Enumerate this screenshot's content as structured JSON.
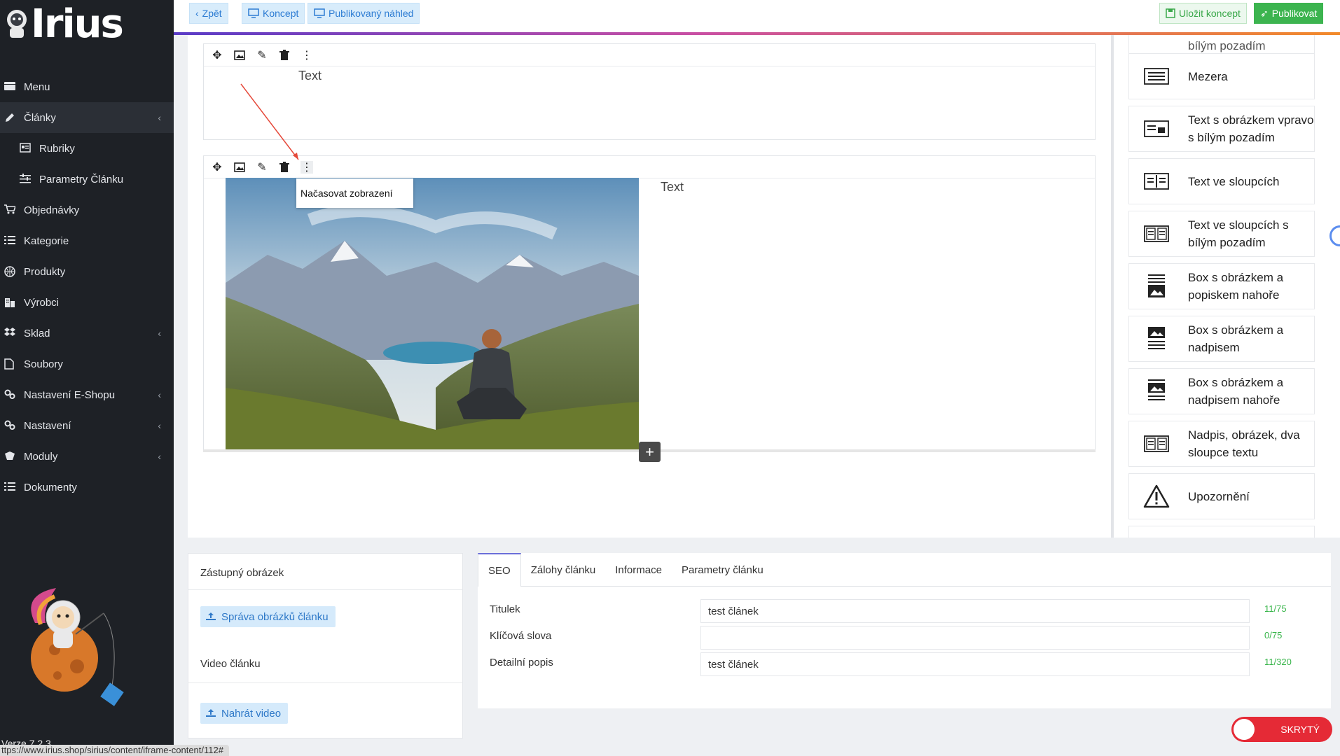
{
  "app": {
    "logo_text": "Irius",
    "version": "Verze 7.2.3",
    "status_url": "ttps://www.irius.shop/sirius/content/iframe-content/112#"
  },
  "sidebar": {
    "items": [
      {
        "label": "Menu",
        "icon": "menu-icon",
        "active": false,
        "sub": false,
        "chevron": false
      },
      {
        "label": "Články",
        "icon": "pencil-icon",
        "active": true,
        "sub": false,
        "chevron": true
      },
      {
        "label": "Rubriky",
        "icon": "newspaper-icon",
        "active": false,
        "sub": true,
        "chevron": false
      },
      {
        "label": "Parametry Článku",
        "icon": "sliders-icon",
        "active": false,
        "sub": true,
        "chevron": false
      },
      {
        "label": "Objednávky",
        "icon": "cart-icon",
        "active": false,
        "sub": false,
        "chevron": false
      },
      {
        "label": "Kategorie",
        "icon": "list-icon",
        "active": false,
        "sub": false,
        "chevron": false
      },
      {
        "label": "Produkty",
        "icon": "basketball-icon",
        "active": false,
        "sub": false,
        "chevron": false
      },
      {
        "label": "Výrobci",
        "icon": "building-icon",
        "active": false,
        "sub": false,
        "chevron": false
      },
      {
        "label": "Sklad",
        "icon": "dropbox-icon",
        "active": false,
        "sub": false,
        "chevron": true
      },
      {
        "label": "Soubory",
        "icon": "file-icon",
        "active": false,
        "sub": false,
        "chevron": false
      },
      {
        "label": "Nastavení E-Shopu",
        "icon": "cogs-icon",
        "active": false,
        "sub": false,
        "chevron": true
      },
      {
        "label": "Nastavení",
        "icon": "cogs-icon",
        "active": false,
        "sub": false,
        "chevron": true
      },
      {
        "label": "Moduly",
        "icon": "modules-icon",
        "active": false,
        "sub": false,
        "chevron": true
      },
      {
        "label": "Dokumenty",
        "icon": "list-icon",
        "active": false,
        "sub": false,
        "chevron": false
      }
    ]
  },
  "topbar": {
    "back": "Zpět",
    "draft": "Koncept",
    "published_preview": "Publikovaný náhled",
    "save_draft": "Uložit koncept",
    "publish": "Publikovat"
  },
  "editor": {
    "block1_text": "Text",
    "block2_text": "Text",
    "tooltip": "Načasovat zobrazení"
  },
  "palette": {
    "cut_top_label": "bílým pozadím",
    "items": [
      {
        "label": "Mezera",
        "icon": "text-align-icon"
      },
      {
        "label": "Text s obrázkem vpravo s bílým pozadím",
        "icon": "text-image-right-icon"
      },
      {
        "label": "Text ve sloupcích",
        "icon": "columns-icon"
      },
      {
        "label": "Text ve sloupcích s bílým pozadím",
        "icon": "columns-bordered-icon"
      },
      {
        "label": "Box s obrázkem a popiskem nahoře",
        "icon": "box-caption-top-icon"
      },
      {
        "label": "Box s obrázkem a nadpisem",
        "icon": "box-heading-icon"
      },
      {
        "label": "Box s obrázkem a nadpisem nahoře",
        "icon": "box-heading-top-icon"
      },
      {
        "label": "Nadpis, obrázek, dva sloupce textu",
        "icon": "columns-bordered-icon"
      },
      {
        "label": "Upozornění",
        "icon": "warning-icon"
      }
    ]
  },
  "left_card": {
    "image_label": "Zástupný obrázek",
    "image_button": "Správa obrázků článku",
    "video_label": "Video článku",
    "video_button": "Nahrát video"
  },
  "seo": {
    "tabs": [
      "SEO",
      "Zálohy článku",
      "Informace",
      "Parametry článku"
    ],
    "rows": [
      {
        "label": "Titulek",
        "value": "test článek",
        "count": "11/75"
      },
      {
        "label": "Klíčová slova",
        "value": "",
        "count": "0/75"
      },
      {
        "label": "Detailní popis",
        "value": "test článek",
        "count": "11/320"
      }
    ]
  },
  "visibility_toggle": {
    "label": "SKRYTÝ"
  },
  "colors": {
    "accent_blue": "#2d7cd3",
    "publish_green": "#3cb44f",
    "toggle_red": "#e52a36",
    "counter_green": "#38b54a"
  }
}
